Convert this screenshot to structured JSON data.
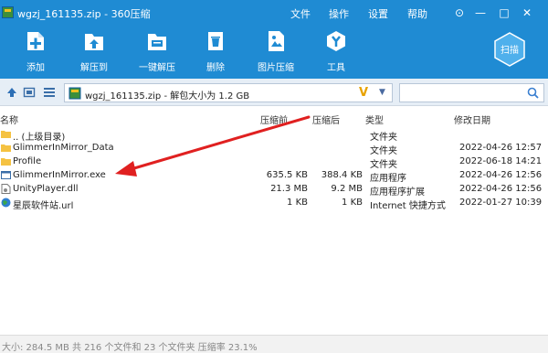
{
  "window": {
    "title": "wgzj_161135.zip - 360压缩",
    "menu": [
      "文件",
      "操作",
      "设置",
      "帮助"
    ],
    "controls": [
      "⊙",
      "—",
      "□",
      "✕"
    ]
  },
  "toolbar": {
    "items": [
      {
        "label": "添加",
        "icon": "add-icon"
      },
      {
        "label": "解压到",
        "icon": "extract-to-icon"
      },
      {
        "label": "一键解压",
        "icon": "one-click-extract-icon"
      },
      {
        "label": "删除",
        "icon": "delete-icon"
      },
      {
        "label": "图片压缩",
        "icon": "image-compress-icon"
      },
      {
        "label": "工具",
        "icon": "tools-icon"
      }
    ],
    "scan_label": "扫描"
  },
  "address": {
    "path": "wgzj_161135.zip - 解包大小为 1.2 GB",
    "search_placeholder": ""
  },
  "columns": {
    "name": "名称",
    "compressed": "压缩前",
    "packed": "压缩后",
    "type": "类型",
    "modified": "修改日期"
  },
  "files": [
    {
      "name": ".. (上级目录)",
      "compressed": "",
      "packed": "",
      "type": "文件夹",
      "modified": "",
      "icon": "folder-icon"
    },
    {
      "name": "GlimmerInMirror_Data",
      "compressed": "",
      "packed": "",
      "type": "文件夹",
      "modified": "2022-04-26 12:57",
      "icon": "folder-icon"
    },
    {
      "name": "Profile",
      "compressed": "",
      "packed": "",
      "type": "文件夹",
      "modified": "2022-06-18 14:21",
      "icon": "folder-icon"
    },
    {
      "name": "GlimmerInMirror.exe",
      "compressed": "635.5 KB",
      "packed": "388.4 KB",
      "type": "应用程序",
      "modified": "2022-04-26 12:56",
      "icon": "exe-icon"
    },
    {
      "name": "UnityPlayer.dll",
      "compressed": "21.3 MB",
      "packed": "9.2 MB",
      "type": "应用程序扩展",
      "modified": "2022-04-26 12:56",
      "icon": "dll-icon"
    },
    {
      "name": "星辰软件站.url",
      "compressed": "1 KB",
      "packed": "1 KB",
      "type": "Internet 快捷方式",
      "modified": "2022-01-27 10:39",
      "icon": "globe-icon"
    }
  ],
  "status": "大小: 284.5 MB 共 216 个文件和 23 个文件夹 压缩率 23.1%",
  "colors": {
    "title_bar": "#1f8bd3",
    "annotation_arrow": "#e02020",
    "folder": "#f5c242"
  }
}
